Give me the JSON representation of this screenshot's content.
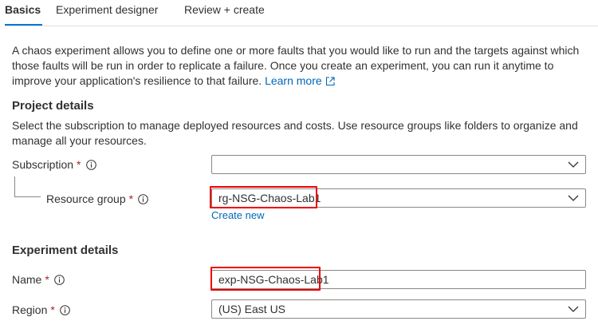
{
  "tabs": [
    {
      "label": "Basics",
      "active": true
    },
    {
      "label": "Experiment designer",
      "active": false
    },
    {
      "label": "Review + create",
      "active": false
    }
  ],
  "intro": {
    "text": "A chaos experiment allows you to define one or more faults that you would like to run and the targets against which those faults will be run in order to replicate a failure. Once you create an experiment, you can run it anytime to improve your application's resilience to that failure.",
    "learn_more": "Learn more"
  },
  "project": {
    "title": "Project details",
    "description": "Select the subscription to manage deployed resources and costs. Use resource groups like folders to organize and manage all your resources.",
    "subscription": {
      "label": "Subscription",
      "required": "*",
      "value": ""
    },
    "resource_group": {
      "label": "Resource group",
      "required": "*",
      "value": "rg-NSG-Chaos-Lab1",
      "create_new": "Create new"
    }
  },
  "experiment": {
    "title": "Experiment details",
    "name": {
      "label": "Name",
      "required": "*",
      "value": "exp-NSG-Chaos-Lab1"
    },
    "region": {
      "label": "Region",
      "required": "*",
      "value": "(US) East US"
    }
  },
  "colors": {
    "link": "#0067b8",
    "accent": "#0078d4",
    "required": "#a4262c",
    "highlight": "#ee0000"
  },
  "icons": [
    "info-icon",
    "chevron-down-icon",
    "external-link-icon"
  ]
}
